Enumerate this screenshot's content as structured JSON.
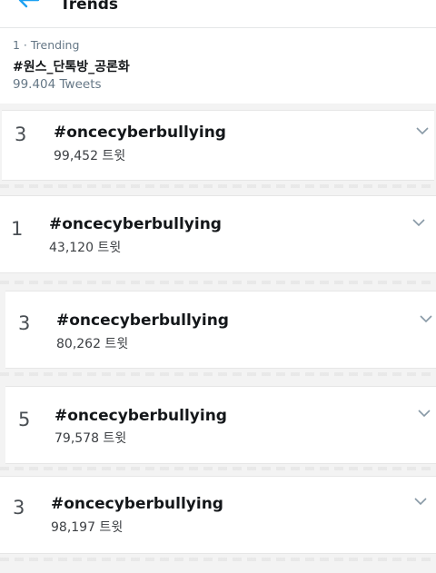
{
  "header": {
    "title": "Trends",
    "back_icon": "back-arrow-icon",
    "accent": "#1da1f2"
  },
  "top_trend": {
    "meta": "1 · Trending",
    "name": "#원스_단톡방_공론화",
    "count": "99.404 Tweets"
  },
  "trends": [
    {
      "rank": "3",
      "tag": "#oncecyberbullying",
      "count": "99,452 트윗"
    },
    {
      "rank": "1",
      "tag": "#oncecyberbullying",
      "count": "43,120 트윗"
    },
    {
      "rank": "3",
      "tag": "#oncecyberbullying",
      "count": "80,262 트윗"
    },
    {
      "rank": "5",
      "tag": "#oncecyberbullying",
      "count": "79,578 트윗"
    },
    {
      "rank": "3",
      "tag": "#oncecyberbullying",
      "count": "98,197 트윗"
    }
  ]
}
